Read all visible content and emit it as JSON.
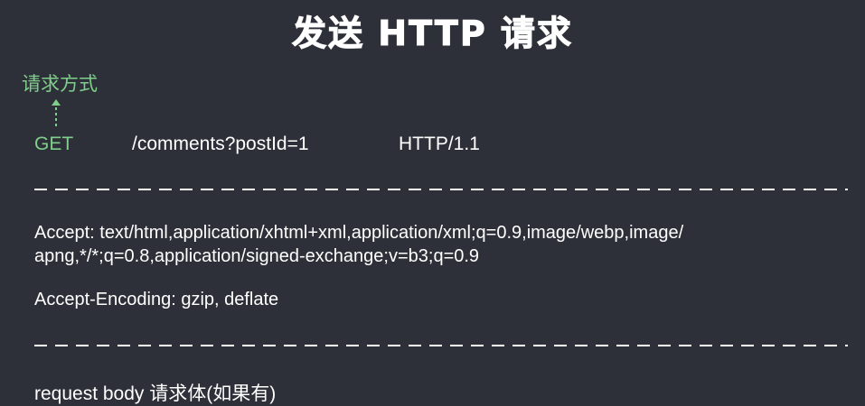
{
  "title": "发送 HTTP 请求",
  "method_caption": "请求方式",
  "request_line": {
    "method": "GET",
    "path": "/comments?postId=1",
    "version": "HTTP/1.1"
  },
  "headers": {
    "accept_line1": "Accept: text/html,application/xhtml+xml,application/xml;q=0.9,image/webp,image/",
    "accept_line2": "apng,*/*;q=0.8,application/signed-exchange;v=b3;q=0.9",
    "accept_encoding": "Accept-Encoding: gzip, deflate"
  },
  "body_label": "request body 请求体(如果有)",
  "colors": {
    "background": "#2e3039",
    "accent_green": "#7fcf8a",
    "text": "#ffffff"
  }
}
